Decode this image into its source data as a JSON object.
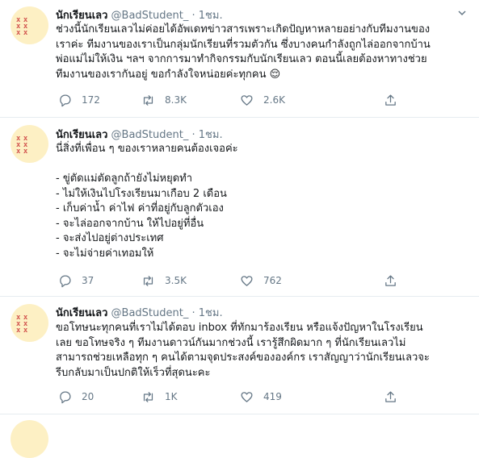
{
  "tweets": [
    {
      "author": {
        "name": "นักเรียนเลว",
        "handle": "@BadStudent_",
        "time": "1ชม."
      },
      "lines": [
        "ช่วงนี้นักเรียนเลวไม่ค่อยได้อัพเดทข่าวสารเพราะเกิดปัญหาหลายอย่างกับทีมงานของ",
        "เราค่ะ ทีมงานของเราเป็นกลุ่มนักเรียนที่รวมตัวกัน ซึ่งบางคนกำลังถูกไล่ออกจากบ้าน",
        "พ่อแม่ไม่ให้เงิน ฯลฯ จากการมาทำกิจกรรมกับนักเรียนเลว ตอนนี้เลยต้องหาทางช่วย",
        "ทีมงานของเรากันอยู่ ขอกำลังใจหน่อยค่ะทุกคน 😌"
      ],
      "reply_count": "172",
      "retweet_count": "8.3K",
      "like_count": "2.6K"
    },
    {
      "author": {
        "name": "นักเรียนเลว",
        "handle": "@BadStudent_",
        "time": "1ชม."
      },
      "lines": [
        "นี่สิ่งที่เพื่อน ๆ ของเราหลายคนต้องเจอค่ะ",
        "",
        "- ขู่ตัดแม่ตัดลูกถ้ายังไม่หยุดทำ",
        "- ไม่ให้เงินไปโรงเรียนมาเกือบ 2 เดือน",
        "- เก็บค่าน้ำ ค่าไฟ ค่าที่อยู่กับลูกตัวเอง",
        "- จะไล่ออกจากบ้าน ให้ไปอยู่ที่อื่น",
        "- จะส่งไปอยู่ต่างประเทศ",
        "- จะไม่จ่ายค่าเทอมให้"
      ],
      "reply_count": "37",
      "retweet_count": "3.5K",
      "like_count": "762"
    },
    {
      "author": {
        "name": "นักเรียนเลว",
        "handle": "@BadStudent_",
        "time": "1ชม."
      },
      "lines": [
        "ขอโทษนะทุกคนที่เราไม่ได้ตอบ inbox ที่ทักมาร้องเรียน หรือแจ้งปัญหาในโรงเรียน",
        "เลย ขอโทษจริง ๆ ทีมงานดาวน์กันมากช่วงนี้ เรารู้สึกผิดมาก ๆ ที่นักเรียนเลวไม่",
        "สามารถช่วยเหลือทุก ๆ คนได้ตามจุดประสงค์ขององค์กร เราสัญญาว่านักเรียนเลวจะ",
        "รีบกลับมาเป็นปกติให้เร็วที่สุดนะคะ"
      ],
      "reply_count": "20",
      "retweet_count": "1K",
      "like_count": "419"
    }
  ],
  "icons": {
    "reply": "reply-icon",
    "retweet": "retweet-icon",
    "like": "heart-icon",
    "share": "share-icon",
    "caret": "chevron-down-icon"
  },
  "colors": {
    "text": "#14171a",
    "muted": "#657786",
    "divider": "#e6ecf0",
    "avatar_bg": "#fdf0c4",
    "avatar_mark": "#d2554f"
  }
}
